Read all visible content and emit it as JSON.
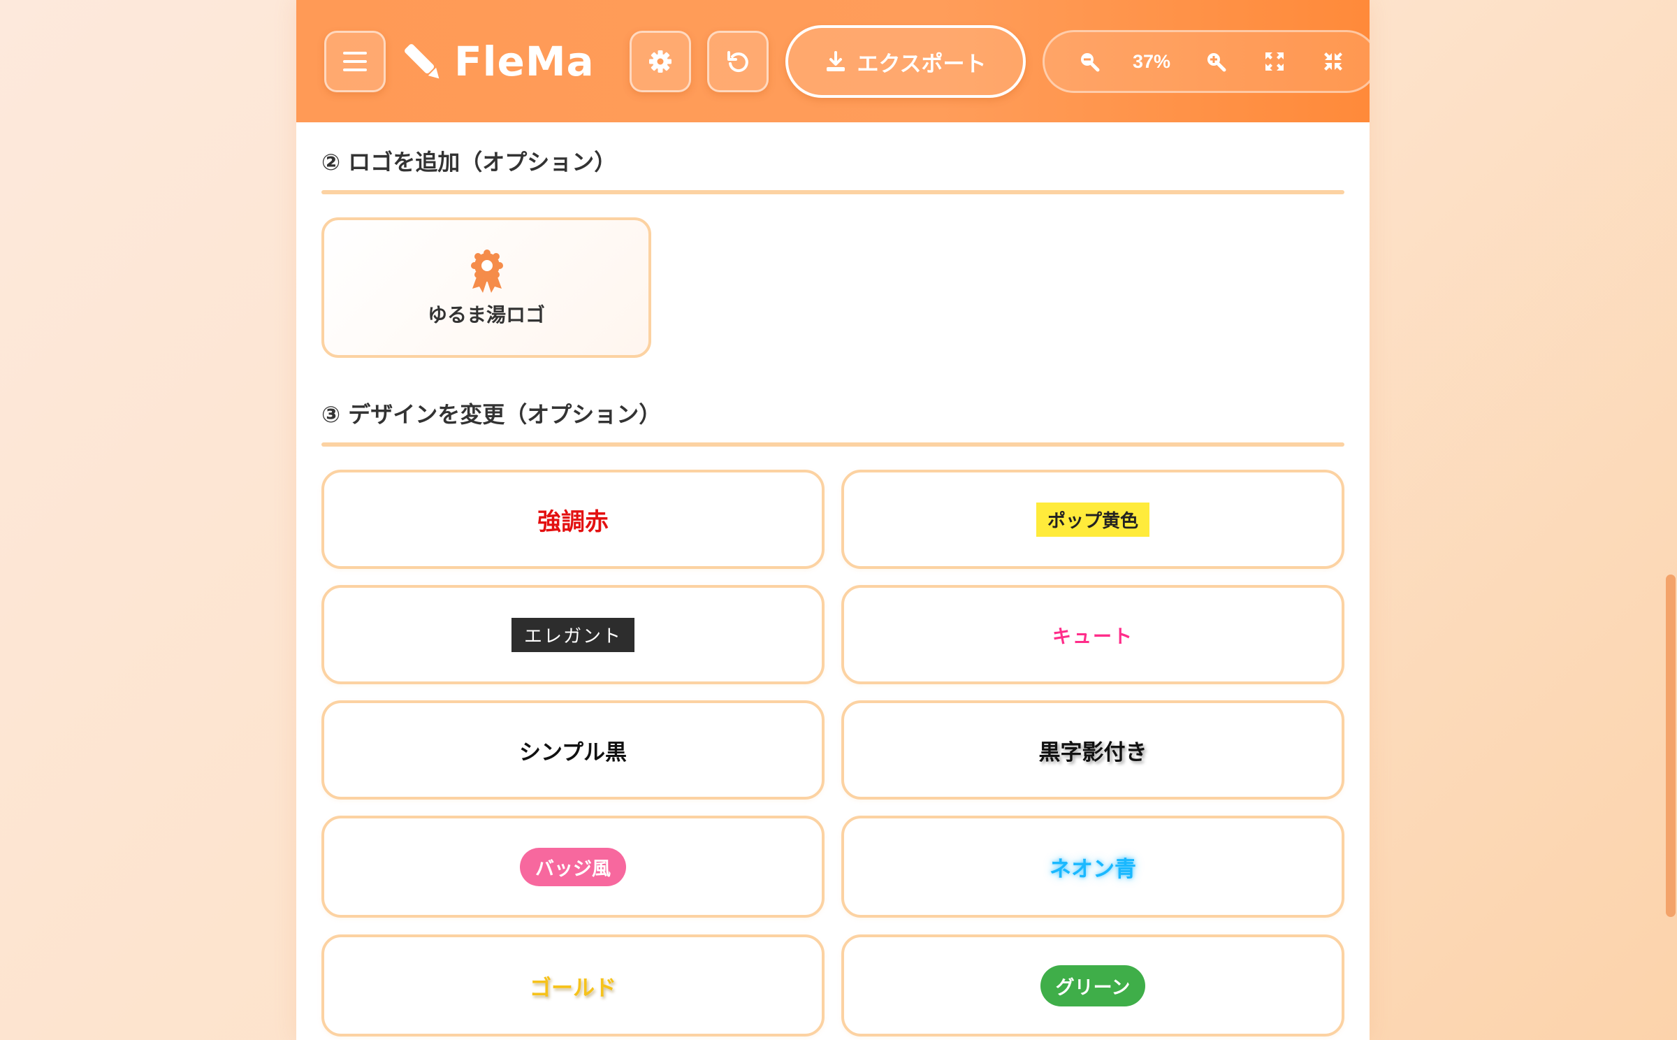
{
  "header": {
    "app_name": "FleMa",
    "export_label": "エクスポート",
    "zoom_level": "37%"
  },
  "icons": {
    "menu": "hamburger-icon",
    "logo": "pen-icon",
    "settings": "gear-icon",
    "undo": "undo-icon",
    "export": "download-icon",
    "zoom_out": "zoom-out-icon",
    "zoom_in": "zoom-in-icon",
    "fit": "expand-icon",
    "shrink": "compress-icon",
    "logo_option": "award-icon"
  },
  "sections": {
    "logo": {
      "title": "② ロゴを追加（オプション）",
      "options": [
        {
          "label": "ゆるま湯ロゴ"
        }
      ]
    },
    "design": {
      "title": "③ デザインを変更（オプション）",
      "styles": [
        {
          "label": "強調赤"
        },
        {
          "label": "ポップ黄色"
        },
        {
          "label": "エレガント"
        },
        {
          "label": "キュート"
        },
        {
          "label": "シンプル黒"
        },
        {
          "label": "黒字影付き"
        },
        {
          "label": "バッジ風"
        },
        {
          "label": "ネオン青"
        },
        {
          "label": "ゴールド"
        },
        {
          "label": "グリーン"
        }
      ]
    }
  },
  "colors": {
    "header_gradient_start": "#ff9a56",
    "header_gradient_end": "#ff8a3a",
    "card_border": "#fcd2a2",
    "accent_orange": "#f58c4a",
    "style_red": "#e31010",
    "style_pop_bg": "#ffeb3b",
    "style_elegant_bg": "#2d2d2d",
    "style_cute": "#ff2d8a",
    "style_badge_bg": "#f7689e",
    "style_neon": "#19b8ff",
    "style_gold": "#f6c21a",
    "style_green_bg": "#3fae49"
  }
}
